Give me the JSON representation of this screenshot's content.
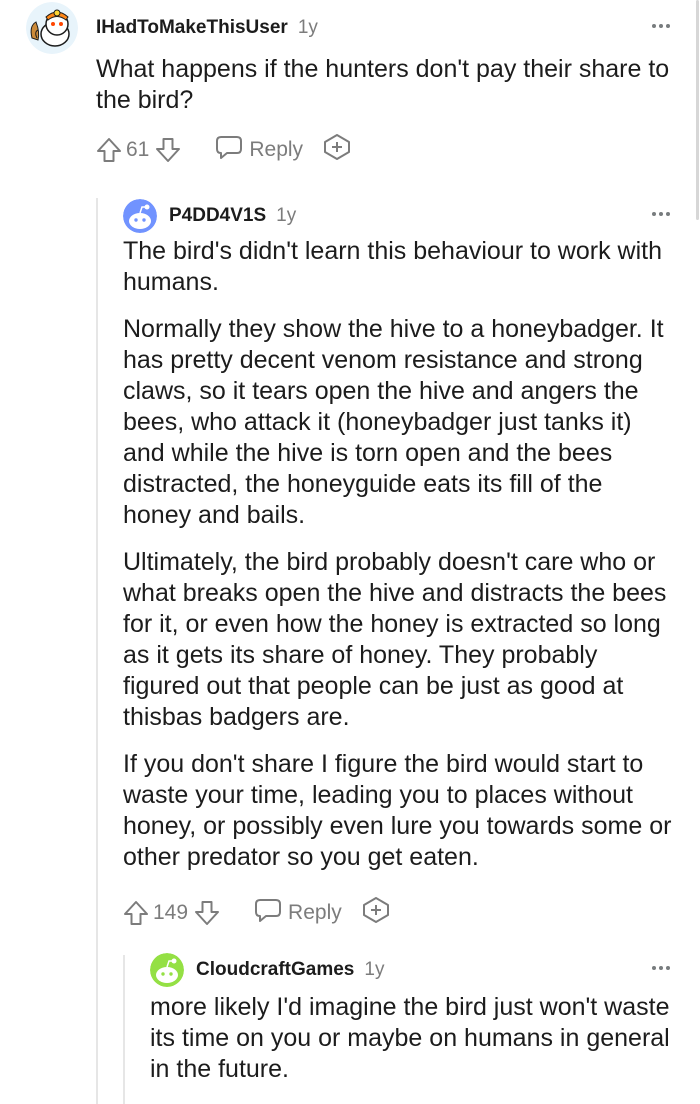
{
  "comments": [
    {
      "author": "IHadToMakeThisUser",
      "age": "1y",
      "paragraphs": [
        "What happens if the hunters don't pay their share to the bird?"
      ],
      "score": "61",
      "reply_label": "Reply",
      "avatar_color": "#ff8717"
    },
    {
      "author": "P4DD4V1S",
      "age": "1y",
      "paragraphs": [
        "The bird's didn't learn this behaviour to work with humans.",
        "Normally they show the hive to a honeybadger. It has pretty decent venom resistance and strong claws, so it tears open the hive and angers the bees, who attack it (honeybadger just tanks it) and while the hive is torn open and the bees distracted, the honeyguide eats its fill of the honey and bails.",
        "Ultimately, the bird probably doesn't care who or what breaks open the hive and distracts the bees for it, or even how the honey is extracted so long as it gets its share of honey. They probably figured out that people can be just as good at thisbas badgers are.",
        "If you don't share I figure the bird would start to waste your time, leading you to places without honey, or possibly even lure you towards some or other predator so you get eaten."
      ],
      "score": "149",
      "reply_label": "Reply",
      "avatar_color": "#7193ff"
    },
    {
      "author": "CloudcraftGames",
      "age": "1y",
      "paragraphs": [
        "more likely I'd imagine the bird just won't waste its time on you or maybe on humans in general in the future."
      ],
      "avatar_color": "#94e044"
    }
  ],
  "icons": {
    "upvote": "arrow-up-outline",
    "downvote": "arrow-down-outline",
    "reply": "speech-bubble",
    "award": "award-plus",
    "more": "three-dots"
  },
  "colors": {
    "text": "#1c1c1c",
    "meta": "#7c7c7c",
    "thread_line": "#e6e6e6"
  }
}
